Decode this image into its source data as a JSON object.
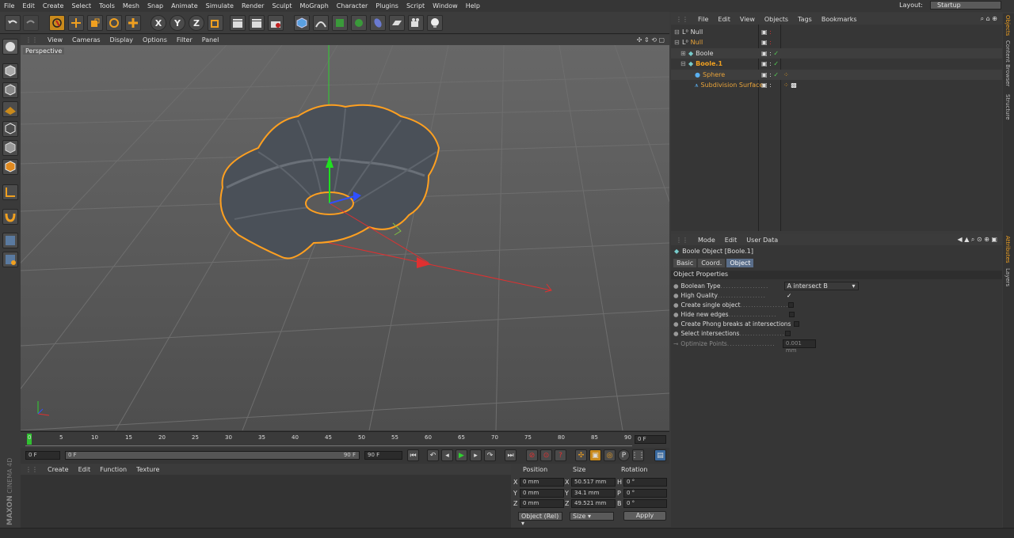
{
  "menu": [
    "File",
    "Edit",
    "Create",
    "Select",
    "Tools",
    "Mesh",
    "Snap",
    "Animate",
    "Simulate",
    "Render",
    "Sculpt",
    "MoGraph",
    "Character",
    "Plugins",
    "Script",
    "Window",
    "Help"
  ],
  "layout": {
    "label": "Layout:",
    "value": "Startup"
  },
  "toolbar": {
    "x": "X",
    "y": "Y",
    "z": "Z"
  },
  "viewport": {
    "menu": [
      "View",
      "Cameras",
      "Display",
      "Options",
      "Filter",
      "Panel"
    ],
    "label": "Perspective"
  },
  "timeline": {
    "ticks": [
      "0",
      "5",
      "10",
      "15",
      "20",
      "25",
      "30",
      "35",
      "40",
      "45",
      "50",
      "55",
      "60",
      "65",
      "70",
      "75",
      "80",
      "85",
      "90"
    ],
    "current_frame": "0 F",
    "start": "0 F",
    "range_start": "0 F",
    "range_end": "90 F",
    "end": "90 F"
  },
  "material": {
    "menu": [
      "Create",
      "Edit",
      "Function",
      "Texture"
    ]
  },
  "brand": {
    "maxon": "MAXON",
    "cinema": "CINEMA 4D"
  },
  "coords": {
    "headers": [
      "Position",
      "Size",
      "Rotation"
    ],
    "rows": [
      {
        "axis": "X",
        "pos": "0 mm",
        "saxis": "X",
        "size": "50.517 mm",
        "raxis": "H",
        "rot": "0 °"
      },
      {
        "axis": "Y",
        "pos": "0 mm",
        "saxis": "Y",
        "size": "34.1 mm",
        "raxis": "P",
        "rot": "0 °"
      },
      {
        "axis": "Z",
        "pos": "0 mm",
        "saxis": "Z",
        "size": "49.521 mm",
        "raxis": "B",
        "rot": "0 °"
      }
    ],
    "mode": "Object (Rel)",
    "size_mode": "Size",
    "apply": "Apply"
  },
  "objects": {
    "menu": [
      "File",
      "Edit",
      "View",
      "Objects",
      "Tags",
      "Bookmarks"
    ],
    "items": [
      {
        "name": "Null",
        "color": "#dddddd"
      },
      {
        "name": "Null",
        "color": "#e8a33a"
      },
      {
        "name": "Boole",
        "color": "#dddddd"
      },
      {
        "name": "Boole.1",
        "color": "#f0a020"
      },
      {
        "name": "Sphere",
        "color": "#e8a33a"
      },
      {
        "name": "Subdivision Surface",
        "color": "#e8a33a"
      }
    ]
  },
  "attributes": {
    "menu": [
      "Mode",
      "Edit",
      "User Data"
    ],
    "title": "Boole Object [Boole.1]",
    "tabs": [
      "Basic",
      "Coord.",
      "Object"
    ],
    "section": "Object Properties",
    "props": [
      {
        "label": "Boolean Type",
        "value": "A intersect B"
      },
      {
        "label": "High Quality",
        "checked": true
      },
      {
        "label": "Create single object",
        "checked": false
      },
      {
        "label": "Hide new edges",
        "checked": false
      },
      {
        "label": "Create Phong breaks at intersections",
        "checked": false
      },
      {
        "label": "Select intersections",
        "checked": false
      },
      {
        "label": "Optimize Points",
        "value": "0.001 mm"
      }
    ]
  },
  "right_tabs": [
    "Objects",
    "Content Browser",
    "Structure",
    "Attributes",
    "Layers"
  ],
  "colors": {
    "accent": "#f0a020",
    "selection": "#ff9a1a",
    "axis_x": "#e03030",
    "axis_y": "#30d030",
    "axis_z": "#3050ff"
  }
}
